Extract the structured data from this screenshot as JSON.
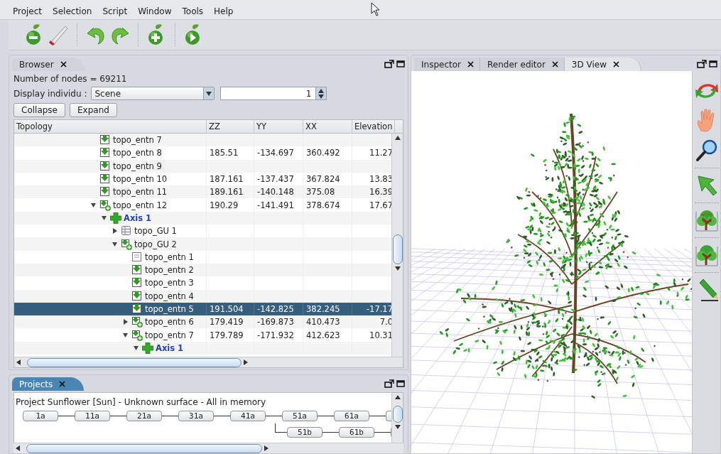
{
  "menu": [
    "Project",
    "Selection",
    "Script",
    "Window",
    "Tools",
    "Help"
  ],
  "browser": {
    "tab": {
      "label": "Browser",
      "focused": false
    },
    "node_count": "Number of nodes = 69211",
    "display_label": "Display individu :",
    "display_value": "Scene",
    "spinner_value": "1",
    "buttons": [
      "Collapse",
      "Expand"
    ],
    "columns": [
      "Topology",
      "ZZ",
      "YY",
      "XX",
      "Elevation"
    ],
    "rows": [
      {
        "label": "topo_entn 7",
        "kind": "entity",
        "selected": false
      },
      {
        "label": "topo_entn 8",
        "kind": "entity",
        "selected": false,
        "zz": "185.51",
        "yy": "-134.697",
        "xx": "360.492",
        "elevation": "11.27"
      },
      {
        "label": "topo_entn 9",
        "kind": "entity",
        "selected": false
      },
      {
        "label": "topo_entn 10",
        "kind": "entity",
        "selected": false,
        "zz": "187.161",
        "yy": "-137.437",
        "xx": "367.824",
        "elevation": "13.83"
      },
      {
        "label": "topo_entn 11",
        "kind": "entity",
        "selected": false,
        "zz": "189.161",
        "yy": "-140.148",
        "xx": "375.08",
        "elevation": "16.39"
      },
      {
        "label": "topo_entn 12",
        "kind": "group",
        "expanded": true,
        "selected": false,
        "zz": "190.29",
        "yy": "-141.491",
        "xx": "378.674",
        "elevation": "17.67",
        "children": [
          {
            "label": "Axis 1",
            "kind": "axis",
            "expanded": true,
            "selected": false,
            "children": [
              {
                "label": "topo_GU 1",
                "kind": "gu",
                "expanded": false,
                "selected": false
              },
              {
                "label": "topo_GU 2",
                "kind": "group",
                "expanded": true,
                "selected": false,
                "children": [
                  {
                    "label": "topo_entn 1",
                    "kind": "blank",
                    "selected": false
                  },
                  {
                    "label": "topo_entn 2",
                    "kind": "entity",
                    "selected": false
                  },
                  {
                    "label": "topo_entn 3",
                    "kind": "entity",
                    "selected": false
                  },
                  {
                    "label": "topo_entn 4",
                    "kind": "entity",
                    "selected": false
                  },
                  {
                    "label": "topo_entn 5",
                    "kind": "entity",
                    "selected": true,
                    "zz": "191.504",
                    "yy": "-142.825",
                    "xx": "382.245",
                    "elevation": "-17.17"
                  },
                  {
                    "label": "topo_entn 6",
                    "kind": "group",
                    "expanded": false,
                    "selected": false,
                    "zz": "179.419",
                    "yy": "-169.873",
                    "xx": "410.473",
                    "elevation": "7.0"
                  },
                  {
                    "label": "topo_entn 7",
                    "kind": "group",
                    "expanded": true,
                    "selected": false,
                    "zz": "179.789",
                    "yy": "-171.932",
                    "xx": "412.623",
                    "elevation": "10.31",
                    "children": [
                      {
                        "label": "Axis 1",
                        "kind": "axis",
                        "expanded": true,
                        "selected": false
                      }
                    ]
                  }
                ]
              }
            ]
          }
        ]
      }
    ]
  },
  "view_tabs": [
    {
      "label": "Inspector",
      "selected": false
    },
    {
      "label": "Render editor",
      "selected": false
    },
    {
      "label": "3D View",
      "selected": true
    }
  ],
  "projects": {
    "tab": {
      "label": "Projects",
      "focused": true
    },
    "title": "Project Sunflower [Sun] - Unknown surface - All in memory",
    "main_scales": [
      "1a",
      "11a",
      "21a",
      "31a",
      "41a",
      "51a",
      "61a"
    ],
    "branch_scales": [
      "51b",
      "61b"
    ]
  }
}
